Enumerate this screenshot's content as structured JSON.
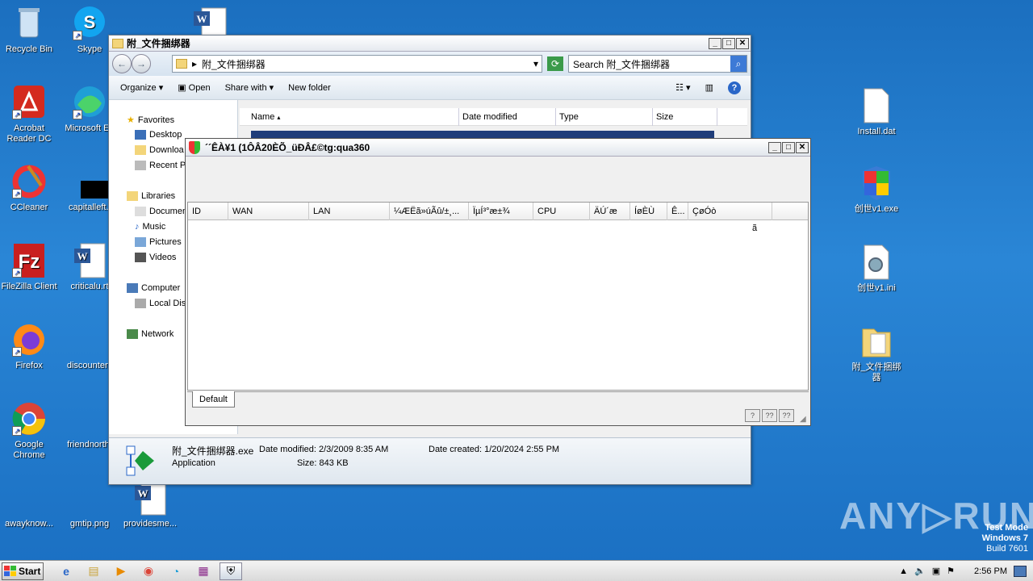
{
  "desktop": {
    "icons": [
      {
        "label": "Recycle Bin",
        "icon": "recycle-bin-icon"
      },
      {
        "label": "Skype",
        "icon": "skype-icon"
      },
      {
        "label": "Acrobat Reader DC",
        "icon": "acrobat-icon"
      },
      {
        "label": "Microsoft Ed",
        "icon": "edge-icon"
      },
      {
        "label": "CCleaner",
        "icon": "ccleaner-icon"
      },
      {
        "label": "capitalleft.j",
        "icon": "image-file-icon"
      },
      {
        "label": "FileZilla Client",
        "icon": "filezilla-icon"
      },
      {
        "label": "criticalu.rt",
        "icon": "word-doc-icon"
      },
      {
        "label": "Firefox",
        "icon": "firefox-icon"
      },
      {
        "label": "discountent",
        "icon": "file-icon"
      },
      {
        "label": "Google Chrome",
        "icon": "chrome-icon"
      },
      {
        "label": "friendnorth.",
        "icon": "file-icon"
      },
      {
        "label": "awayknow...",
        "icon": "file-icon"
      },
      {
        "label": "gmtip.png",
        "icon": "image-file-icon"
      },
      {
        "label": "providesme...",
        "icon": "word-doc-icon"
      },
      {
        "label": "Install.dat",
        "icon": "file-icon"
      },
      {
        "label": "创世v1.exe",
        "icon": "shield-icon"
      },
      {
        "label": "创世v1.ini",
        "icon": "settings-file-icon"
      },
      {
        "label": "附_文件捆绑器",
        "icon": "folder-icon"
      }
    ]
  },
  "explorer": {
    "title": "附_文件捆绑器",
    "address": "附_文件捆绑器",
    "search_placeholder": "Search 附_文件捆绑器",
    "toolbar": {
      "organize": "Organize",
      "open": "Open",
      "share": "Share with",
      "new_folder": "New folder"
    },
    "nav": {
      "favorites": "Favorites",
      "desktop": "Desktop",
      "downloads": "Downloa",
      "recent": "Recent Places",
      "libraries": "Libraries",
      "documents": "Documen",
      "music": "Music",
      "pictures": "Pictures",
      "videos": "Videos",
      "computer": "Computer",
      "local_disk": "Local Disk (C:)",
      "network": "Network"
    },
    "columns": {
      "name": "Name",
      "date": "Date modified",
      "type": "Type",
      "size": "Size"
    },
    "details": {
      "filename": "附_文件捆绑器.exe",
      "type": "Application",
      "date_modified_label": "Date modified:",
      "date_modified": "2/3/2009 8:35 AM",
      "size_label": "Size:",
      "size": "843 KB",
      "date_created_label": "Date created:",
      "date_created": "1/20/2024 2:55 PM"
    }
  },
  "dialog": {
    "title": "´´ÊÀ¥1 (1ÔÂ20ÈÕ_üÐÂ£©tg:qua360",
    "columns": [
      "ID",
      "WAN",
      "LAN",
      "¼ÆËã»úÃû/±¸...",
      "ÏµÍ³°æ±¾",
      "CPU",
      "ÄÚ´æ",
      "ÍøÈÙ",
      "Ê...",
      "ÇøÓò"
    ],
    "tab": "Default",
    "stray": "ã"
  },
  "taskbar": {
    "start": "Start",
    "clock": "2:56 PM"
  },
  "watermark": "ANY▷RUN",
  "testmode": {
    "line1": "Test Mode",
    "line2": "Windows 7",
    "line3": "Build 7601"
  }
}
